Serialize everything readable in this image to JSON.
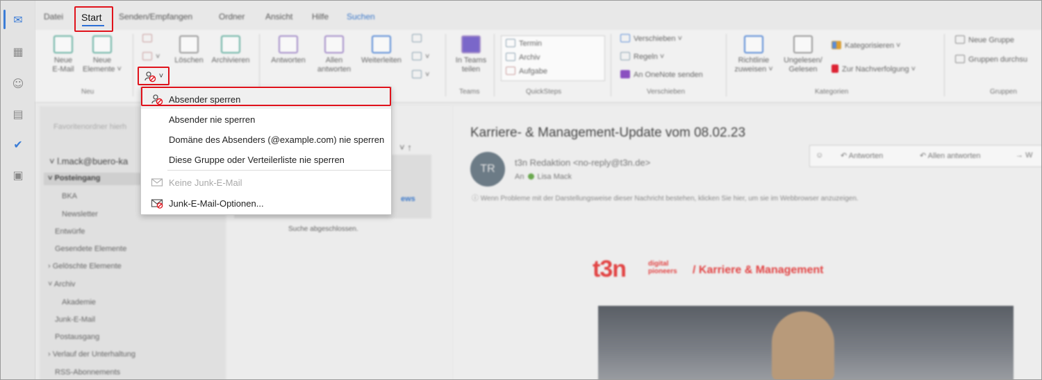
{
  "tabs": {
    "datei": "Datei",
    "start": "Start",
    "senden": "Senden/Empfangen",
    "ordner": "Ordner",
    "ansicht": "Ansicht",
    "hilfe": "Hilfe",
    "suchen": "Suchen"
  },
  "ribbon": {
    "neue_email": "Neue\nE-Mail",
    "neue_elemente": "Neue\nElemente ˅",
    "group_neu": "Neu",
    "loeschen": "Löschen",
    "archivieren": "Archivieren",
    "antworten": "Antworten",
    "allen_antworten": "Allen\nantworten",
    "weiterleiten": "Weiterleiten",
    "in_teams_teilen": "In Teams\nteilen",
    "group_teams": "Teams",
    "qs_termin": "Termin",
    "qs_archiv": "Archiv",
    "qs_aufgabe": "Aufgabe",
    "group_quicksteps": "QuickSteps",
    "verschieben": "Verschieben ˅",
    "regeln": "Regeln ˅",
    "onenote": "An OneNote senden",
    "group_verschieben": "Verschieben",
    "richtlinie": "Richtlinie\nzuweisen ˅",
    "ungelesen": "Ungelesen/\nGelesen",
    "kategorisieren": "Kategorisieren ˅",
    "nachverfolgung": "Zur Nachverfolgung ˅",
    "group_kategorien": "Kategorien",
    "neue_gruppe": "Neue Gruppe",
    "gruppen_durchsuchen": "Gruppen durchsu",
    "group_gruppen": "Gruppen"
  },
  "junk_button": {
    "chevron": "˅"
  },
  "junk_menu": {
    "items": [
      {
        "label": "Absender sperren",
        "enabled": true,
        "icon": "block-sender-icon"
      },
      {
        "label": "Absender nie sperren",
        "enabled": true
      },
      {
        "label": "Domäne des Absenders (@example.com) nie sperren",
        "enabled": true
      },
      {
        "label": "Diese Gruppe oder Verteilerliste nie sperren",
        "enabled": true
      },
      {
        "label": "Keine Junk-E-Mail",
        "enabled": false,
        "icon": "envelope-icon"
      },
      {
        "label": "Junk-E-Mail-Optionen...",
        "enabled": true,
        "icon": "junk-options-icon"
      }
    ]
  },
  "folders": {
    "favorites": "Favoritenordner hierh",
    "account": "l.mack@buero-ka",
    "items": [
      "Posteingang",
      "BKA",
      "Newsletter",
      "Entwürfe",
      "Gesendete Elemente",
      "Gelöschte Elemente",
      "Archiv",
      "Akademie",
      "Junk-E-Mail",
      "Postausgang",
      "Verlauf der Unterhaltung",
      "RSS-Abonnements"
    ]
  },
  "message_list": {
    "search_done": "Suche abgeschlossen.",
    "snippet": "ews"
  },
  "reading_pane": {
    "subject": "Karriere- & Management-Update vom 08.02.23",
    "avatar_initials": "TR",
    "sender": "t3n Redaktion <no-reply@t3n.de>",
    "to_label": "An",
    "to_name": "Lisa Mack",
    "info": "Wenn Probleme mit der Darstellungsweise dieser Nachricht bestehen, klicken Sie hier, um sie im Webbrowser anzuzeigen.",
    "action_reply": "Antworten",
    "action_reply_all": "Allen antworten",
    "action_forward": "W",
    "logo_main": "t3n",
    "logo_sub": "digital\npioneers",
    "logo_tag": "/ Karriere & Management"
  },
  "colors": {
    "highlight": "#e0121b",
    "accent": "#2b6fd6",
    "brand_t3n": "#e24444"
  }
}
